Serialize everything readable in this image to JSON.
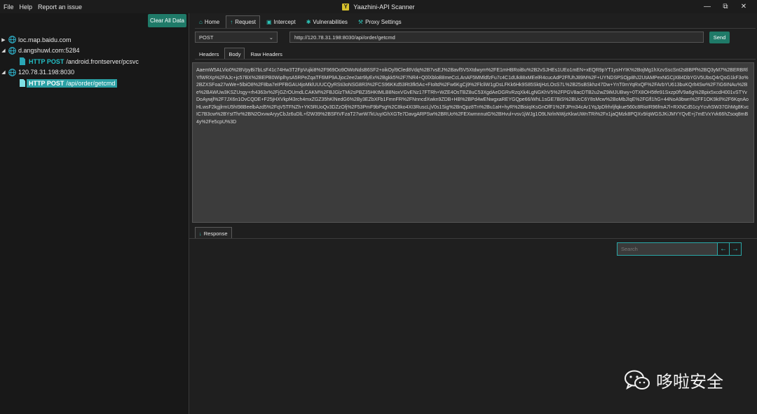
{
  "menu": {
    "file": "File",
    "help": "Help",
    "report": "Report an issue"
  },
  "window": {
    "title": "Yaazhini-API Scanner",
    "icon_letter": "Y",
    "minimize": "—",
    "restore": "⧉",
    "close": "✕"
  },
  "sidebar": {
    "clear_label": "Clear All Data",
    "hosts": [
      {
        "host": "loc.map.baidu.com",
        "expanded": false,
        "requests": []
      },
      {
        "host": "d.angshuwl.com:5284",
        "expanded": true,
        "requests": [
          {
            "method": "HTTP POST",
            "path": "/android.frontserver/pcsvc"
          }
        ]
      },
      {
        "host": "120.78.31.198:8030",
        "expanded": true,
        "requests": [
          {
            "method": "HTTP POST",
            "path": "/api/order/getcmd",
            "selected": true
          }
        ]
      }
    ]
  },
  "nav": {
    "tabs": [
      {
        "label": "Home",
        "icon": "home-icon"
      },
      {
        "label": "Request",
        "icon": "arrow-up-icon",
        "active": true
      },
      {
        "label": "Intercept",
        "icon": "intercept-icon"
      },
      {
        "label": "Vulnerabilities",
        "icon": "bug-icon"
      },
      {
        "label": "Proxy Settings",
        "icon": "wrench-icon"
      }
    ]
  },
  "request": {
    "method": "POST",
    "url": "http://120.78.31.198:8030/api/order/getcmd",
    "send_label": "Send",
    "subtabs": [
      "Headers",
      "Body",
      "Raw Headers"
    ],
    "active_subtab": "Body",
    "body": "AaemW5ALVio0%2BVpyBi7bLsF41c74Hw3T2FpVujki8%2F969Oo9OWoNdsB6SF2+oikOyl9Cled8Vdq%2B7vsEJ%2Bavf5V5Xtdwym%2FE1mHBRoiBu%2B2vSJHEs1UEo1mEN+xEQR9pYT1ysHYIK%2BojMg1hXzvSscSnt2sBBPf%2BQ3yM7%2BERBRlYfWRXp%2FAJc+jc57BX%2BEPB0WiplhysA5RPeZqaTF6MP9AJjoc2ee2atr9lyEx%2Bgkk5%2F7NR4+Q0lXbloB8meCcLAnAF5MMldfzFu7c4C1dUk88xMEelR4cucAdP2FfUhJ89N%2F+UYNDSPSOjp8hJ2UtAMPexNGCjXB4DbYGV5UbsQ4rQoG1kF3o%2BZXSFoa27wWe+5lbiO8%2F8ba7eIPFBGAU4joMklUUUCQyRSti3oNSG8R3%2FCS96KKd53Rt3fk5Ac+FIoltd%2Fw6KgCj9%2FlcliW1gDsLFKk6Hk9S85SktjHzLOsS7L%2B25sBSkhz47Dw+YnT0mYqRxQF%2FArbYU613buKQrlt4Sw%2F7iG6INAu%2Be%2BAWUw3KSZUsgy+rh4363x%2FjGZrOUmdLCAKM%2FBJGlzTMi2sPBZ35HKtMLB8NoxVGvENz17FTRh+WZE4OsTBZ8uC53XgdAeDGRvRzqXk4LgNGKhV5%2FPGV8acDTB2u2wZ9iMJUBwy+0TX8OH5tfe91Sxzp0fV9a6g%2Bpix5xcdH001vSTYvDoAywjl%2F7JX6n1OvCQDE+F25jHXVkpf43rch4mxZGZ35hKlNedG6%2By3EZbXFb1FmnFR%2FNnncdXwkn9ZDB+HB%2BPd4wENwgxaREYGQpe66/WhL1sGE7BiS%2BUcC6Y8sMcw%2BoMbJIqE%2FGfl1hG+44NoA9bwn%2FF1OK9kIl%2F6KqnAoHLwsF2kgjlrmU5hI98BeelbAzd5%2FqV5TFNZh+YK5RUoQv3DZzOfj%2F53PmF9bPsg%2C8ko4XI3RuscLjV0s1Sig%2BnQpz8Tn%2Bu1aH+hyR%2BisiqIKsGnOfF1%2FJPm34cAr1YqJpDfrhrljfqkue560c8RioIR96fmA7l+RXNCd51cyYcvhSW37GhMg8KvcIC7B3cw%2BYstThr%2BN2OxvwAryyCbJz6uDlL+f2W39%2BSFtVFzaT27wrW7kUuyIGhXGTe7DavgARPSw%2BRUo%2FEXwmnnutG%2BHvul+vsv1jWJg1O9LNrlnNWjzKkwUWnTRi%2Fx1jaQMzk8PQXv9/qWGSJKiJMYYQvE+j7mEVxYvk66hZsoq8mB4y%2Fe5cpU%3D"
  },
  "response": {
    "tab_label": "Response",
    "search_placeholder": "Search"
  },
  "watermark": {
    "text": "哆啦安全"
  }
}
